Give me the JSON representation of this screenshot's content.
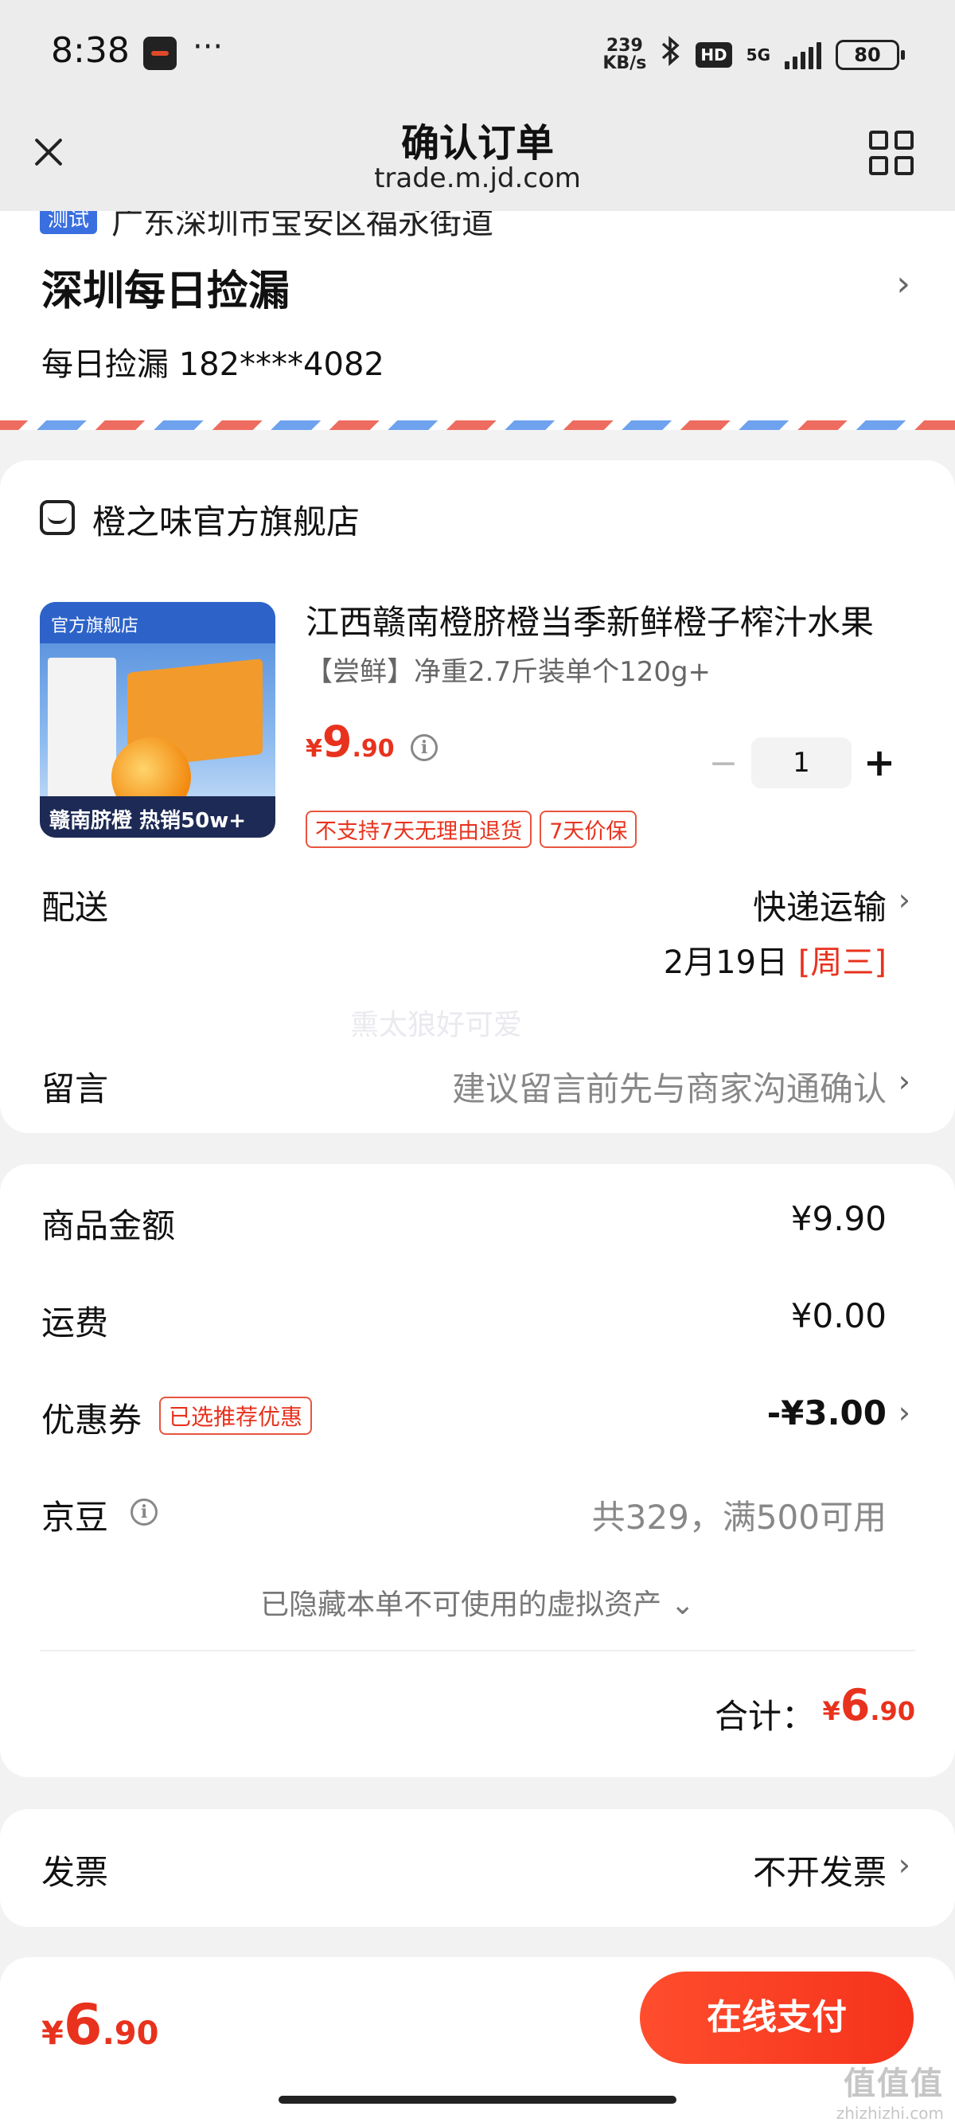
{
  "status_bar": {
    "time": "8:38",
    "dots": "···",
    "net_speed_value": "239",
    "net_speed_unit": "KB/s",
    "hd": "HD",
    "network": "5G",
    "battery": "80"
  },
  "nav": {
    "title": "确认订单",
    "url": "trade.m.jd.com"
  },
  "address": {
    "tag": "测试",
    "region": "广东深圳市宝安区福永街道",
    "name": "深圳每日捡漏",
    "contact": "每日捡漏  182****4082"
  },
  "shop": {
    "name": "橙之味官方旗舰店",
    "product": {
      "image_banner": "官方旗舰店",
      "image_bottom": "赣南脐橙 热销50w+",
      "title": "江西赣南橙脐橙当季新鲜橙子榨汁水果",
      "spec": "【尝鲜】净重2.7斤装单个120g+",
      "price_symbol": "¥",
      "price_int": "9",
      "price_dec": ".90",
      "quantity": "1",
      "tags": [
        "不支持7天无理由退货",
        "7天价保"
      ]
    },
    "delivery_label": "配送",
    "delivery_method": "快递运输",
    "delivery_date": "2月19日",
    "delivery_weekday": "[周三]",
    "watermark": "熏太狼好可爱",
    "message_label": "留言",
    "message_placeholder": "建议留言前先与商家沟通确认"
  },
  "summary": {
    "goods_label": "商品金额",
    "goods_value": "¥9.90",
    "shipping_label": "运费",
    "shipping_value": "¥0.00",
    "coupon_label": "优惠券",
    "coupon_tag": "已选推荐优惠",
    "coupon_value": "-¥3.00",
    "beans_label": "京豆",
    "beans_value": "共329，满500可用",
    "hidden_assets": "已隐藏本单不可使用的虚拟资产",
    "total_label": "合计：",
    "total_symbol": "¥",
    "total_int": "6",
    "total_dec": ".90"
  },
  "invoice": {
    "label": "发票",
    "value": "不开发票"
  },
  "bottom": {
    "price_symbol": "¥",
    "price_int": "6",
    "price_dec": ".90",
    "pay_label": "在线支付"
  },
  "corner": {
    "logo": "值值值",
    "url": "zhizhizhi.com"
  },
  "colors": {
    "accent": "#e8321d",
    "pay_button": "#f5331c"
  }
}
